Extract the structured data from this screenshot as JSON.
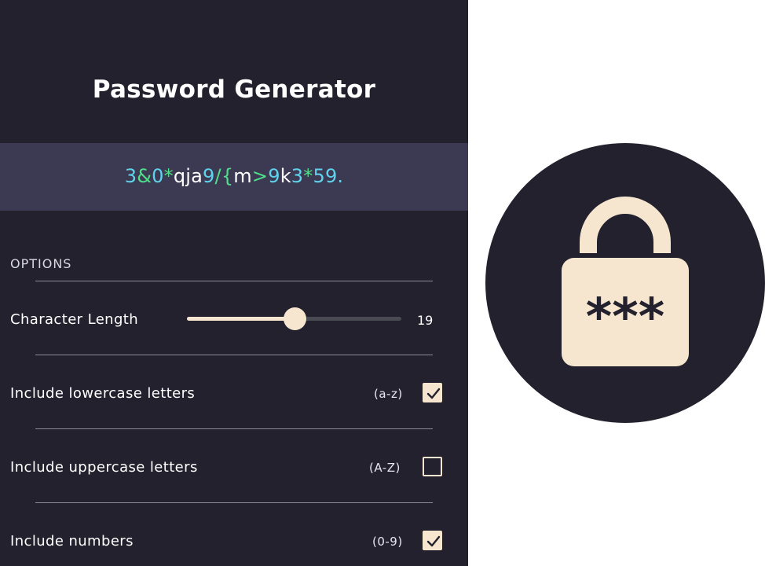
{
  "app": {
    "title": "Password Generator"
  },
  "password": {
    "segments": [
      {
        "text": "3",
        "kind": "num"
      },
      {
        "text": "&",
        "kind": "sym"
      },
      {
        "text": "0",
        "kind": "num"
      },
      {
        "text": "*",
        "kind": "sym"
      },
      {
        "text": "qja",
        "kind": "low"
      },
      {
        "text": "9",
        "kind": "num"
      },
      {
        "text": "/{",
        "kind": "sym"
      },
      {
        "text": "m",
        "kind": "low"
      },
      {
        "text": ">",
        "kind": "sym"
      },
      {
        "text": "9",
        "kind": "num"
      },
      {
        "text": "k",
        "kind": "low"
      },
      {
        "text": "3",
        "kind": "num"
      },
      {
        "text": "*",
        "kind": "sym"
      },
      {
        "text": "59.",
        "kind": "num"
      }
    ]
  },
  "options": {
    "heading": "OPTIONS",
    "length": {
      "label": "Character Length",
      "value": "19",
      "fill_fraction": 0.5
    },
    "lowercase": {
      "label": "Include lowercase letters",
      "hint": "(a-z)",
      "checked": true
    },
    "uppercase": {
      "label": "Include uppercase letters",
      "hint": "(A-Z)",
      "checked": false
    },
    "numbers": {
      "label": "Include numbers",
      "hint": "(0-9)",
      "checked": true
    }
  },
  "illustration": {
    "icon": "padlock-icon",
    "masked_text": "***"
  },
  "colors": {
    "panel_bg": "#22212d",
    "password_band": "#3c3952",
    "accent_cream": "#f6e6cf",
    "numbers_cyan": "#5fd3ec",
    "symbols_green": "#4fe08a"
  }
}
